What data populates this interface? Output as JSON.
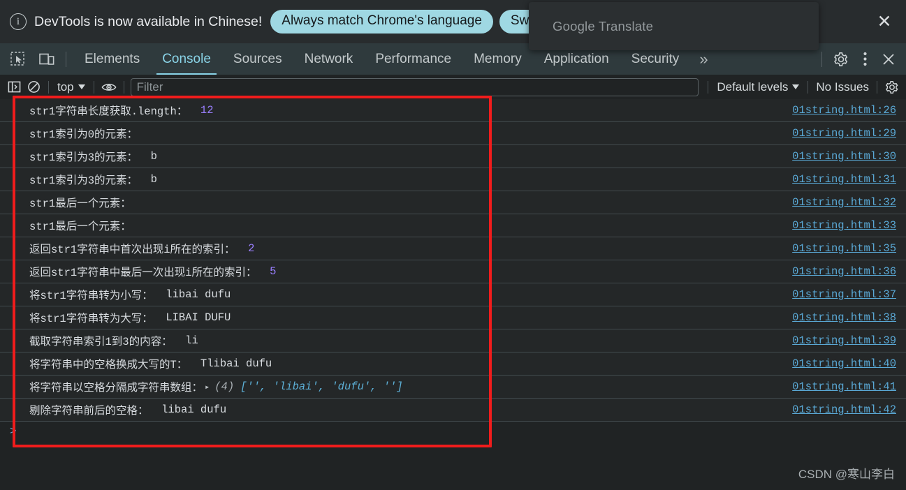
{
  "banner": {
    "icon": "info-circle-icon",
    "message": "DevTools is now available in Chinese!",
    "buttons": [
      {
        "label": "Always match Chrome's language"
      },
      {
        "label": "Switch D"
      }
    ],
    "close_icon": "close-icon"
  },
  "translate_popup": {
    "title": "Google Translate"
  },
  "tabbar": {
    "left_icons": [
      {
        "name": "inspect-element-icon"
      },
      {
        "name": "device-toolbar-icon"
      }
    ],
    "tabs": [
      {
        "label": "Elements",
        "active": false
      },
      {
        "label": "Console",
        "active": true
      },
      {
        "label": "Sources",
        "active": false
      },
      {
        "label": "Network",
        "active": false
      },
      {
        "label": "Performance",
        "active": false
      },
      {
        "label": "Memory",
        "active": false
      },
      {
        "label": "Application",
        "active": false
      },
      {
        "label": "Security",
        "active": false
      }
    ],
    "more_tabs": "»",
    "right_icons": [
      {
        "name": "settings-gear-icon"
      },
      {
        "name": "more-options-icon"
      },
      {
        "name": "close-devtools-icon"
      }
    ]
  },
  "console_toolbar": {
    "sidebar_toggle_icon": "console-sidebar-icon",
    "clear_console_icon": "clear-console-icon",
    "context_selector": "top",
    "live_expression_icon": "eye-icon",
    "filter_placeholder": "Filter",
    "filter_value": "",
    "log_levels": "Default levels",
    "issues": "No Issues",
    "settings_icon": "settings-gear-icon"
  },
  "colors": {
    "accent_blue": "#8ad4e8",
    "link_blue": "#5aa9d6",
    "number_purple": "#9a7fff",
    "string_blue": "#5db0d7",
    "annotation_red": "#f01c1c",
    "banner_button": "#9fd8e3"
  },
  "console_logs": [
    {
      "message": "str1字符串长度获取.length：",
      "value": "12",
      "value_type": "number",
      "source": "01string.html:26"
    },
    {
      "message": "str1索引为0的元素：",
      "value": "",
      "value_type": "text",
      "source": "01string.html:29"
    },
    {
      "message": "str1索引为3的元素：",
      "value": "b",
      "value_type": "text",
      "source": "01string.html:30"
    },
    {
      "message": "str1索引为3的元素：",
      "value": "b",
      "value_type": "text",
      "source": "01string.html:31"
    },
    {
      "message": "str1最后一个元素：",
      "value": "",
      "value_type": "text",
      "source": "01string.html:32"
    },
    {
      "message": "str1最后一个元素：",
      "value": "",
      "value_type": "text",
      "source": "01string.html:33"
    },
    {
      "message": "返回str1字符串中首次出现i所在的索引：",
      "value": "2",
      "value_type": "number",
      "source": "01string.html:35"
    },
    {
      "message": "返回str1字符串中最后一次出现i所在的索引：",
      "value": "5",
      "value_type": "number",
      "source": "01string.html:36"
    },
    {
      "message": "将str1字符串转为小写：",
      "value": "libai dufu",
      "value_type": "text",
      "source": "01string.html:37"
    },
    {
      "message": "将str1字符串转为大写：",
      "value": "LIBAI DUFU",
      "value_type": "text",
      "source": "01string.html:38"
    },
    {
      "message": "截取字符串索引1到3的内容：",
      "value": "li",
      "value_type": "text",
      "source": "01string.html:39"
    },
    {
      "message": "将字符串中的空格换成大写的T：",
      "value": "Tlibai dufu",
      "value_type": "text",
      "source": "01string.html:40"
    },
    {
      "message": "将字符串以空格分隔成字符串数组：",
      "value": "",
      "value_type": "array",
      "array_toggle": "▸",
      "array_count": "(4)",
      "array_preview": "['', 'libai', 'dufu', '']",
      "source": "01string.html:41"
    },
    {
      "message": "剔除字符串前后的空格：",
      "value": "libai dufu",
      "value_type": "text",
      "source": "01string.html:42"
    }
  ],
  "prompt": {
    "caret": ">"
  },
  "watermark": {
    "text": "CSDN @寒山李白"
  }
}
